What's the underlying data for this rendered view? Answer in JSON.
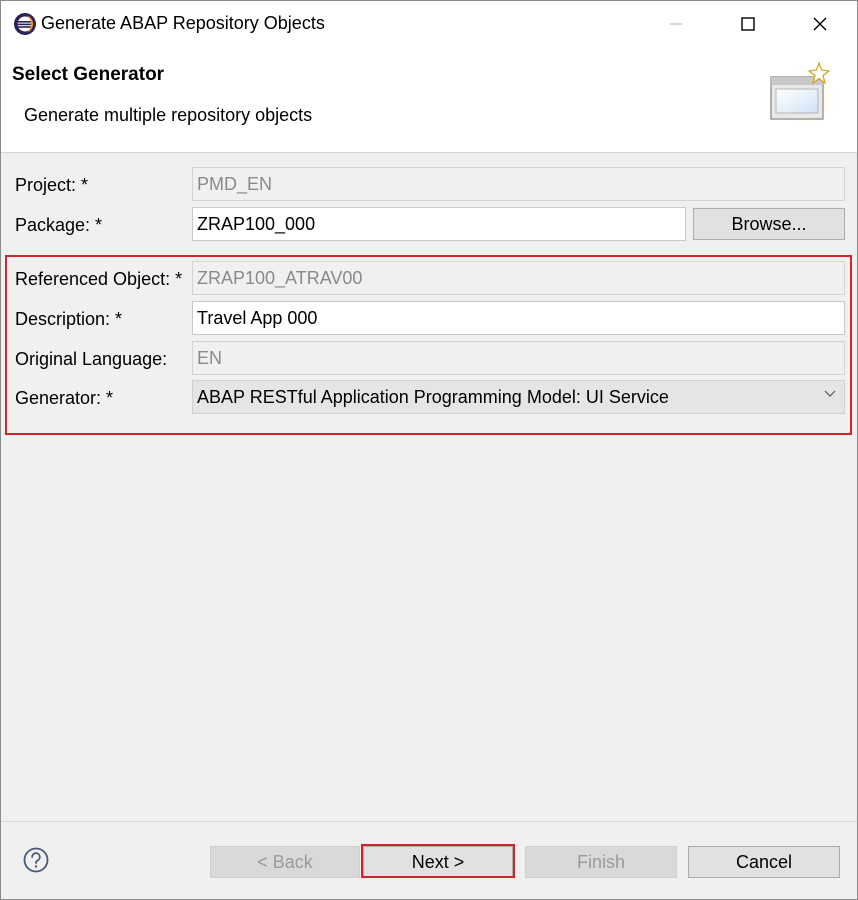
{
  "window": {
    "title": "Generate ABAP Repository Objects",
    "controls": [
      "minimize",
      "maximize",
      "close"
    ]
  },
  "header": {
    "title": "Select Generator",
    "description": "Generate multiple repository objects"
  },
  "form": {
    "project": {
      "label": "Project: *",
      "value": "PMD_EN"
    },
    "package": {
      "label": "Package: *",
      "value": "ZRAP100_000",
      "browse_label": "Browse..."
    },
    "referenced_object": {
      "label": "Referenced Object: *",
      "value": "ZRAP100_ATRAV00"
    },
    "description": {
      "label": "Description: *",
      "value": "Travel App 000"
    },
    "original_language": {
      "label": "Original Language:",
      "value": "EN"
    },
    "generator": {
      "label": "Generator: *",
      "value": "ABAP RESTful Application Programming Model: UI Service"
    }
  },
  "footer": {
    "back_label": "< Back",
    "next_label": "Next >",
    "finish_label": "Finish",
    "cancel_label": "Cancel"
  },
  "colors": {
    "highlight": "#d6232b",
    "window_bg": "#f0f0f0"
  },
  "icons": {
    "app": "eclipse-icon",
    "help": "question-circle-icon",
    "wizard": "wizard-window-sparkle-icon"
  }
}
